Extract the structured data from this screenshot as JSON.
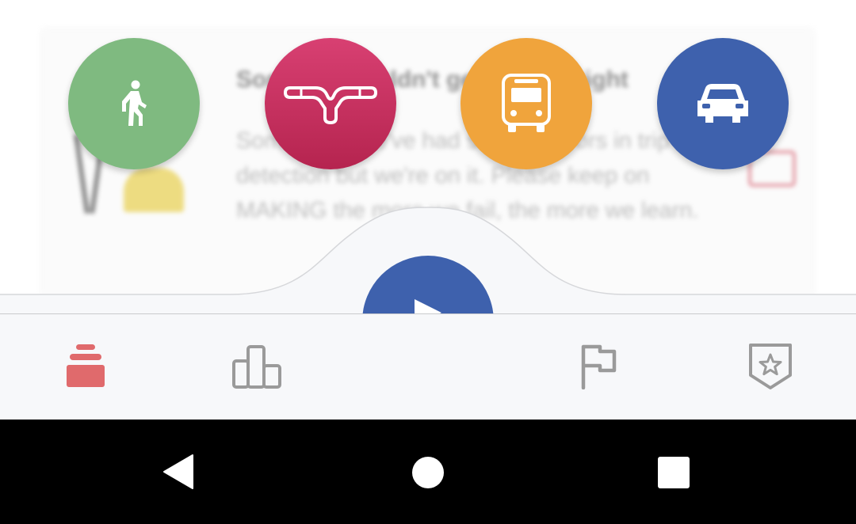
{
  "background_card": {
    "title": "Sorry, we couldn't get the trip right",
    "body": "Sometimes we've had several errors in trip detection but we're on it. Please keep on MAKING the more we fail, the more we learn."
  },
  "transport_modes": [
    {
      "name": "walk",
      "icon": "walking-person-icon",
      "color": "#7fba80"
    },
    {
      "name": "bike",
      "icon": "bicycle-handlebar-icon",
      "color": "#c82f5f"
    },
    {
      "name": "bus",
      "icon": "bus-icon",
      "color": "#f0a43c"
    },
    {
      "name": "car",
      "icon": "car-icon",
      "color": "#3e61ad"
    }
  ],
  "fab": {
    "icon": "play-icon",
    "color": "#3e61ad"
  },
  "bottom_nav": {
    "items": [
      {
        "name": "feed",
        "icon": "stack-icon",
        "active": true,
        "color": "#e06a6c"
      },
      {
        "name": "stats",
        "icon": "bar-chart-icon",
        "active": false,
        "color": "#9a9a9a"
      },
      {
        "name": "goals",
        "icon": "flag-icon",
        "active": false,
        "color": "#9a9a9a"
      },
      {
        "name": "achievements",
        "icon": "badge-star-icon",
        "active": false,
        "color": "#9a9a9a"
      }
    ]
  },
  "system_nav": {
    "buttons": [
      {
        "name": "back",
        "icon": "back-triangle-icon"
      },
      {
        "name": "home",
        "icon": "home-circle-icon"
      },
      {
        "name": "recents",
        "icon": "recents-square-icon"
      }
    ]
  }
}
